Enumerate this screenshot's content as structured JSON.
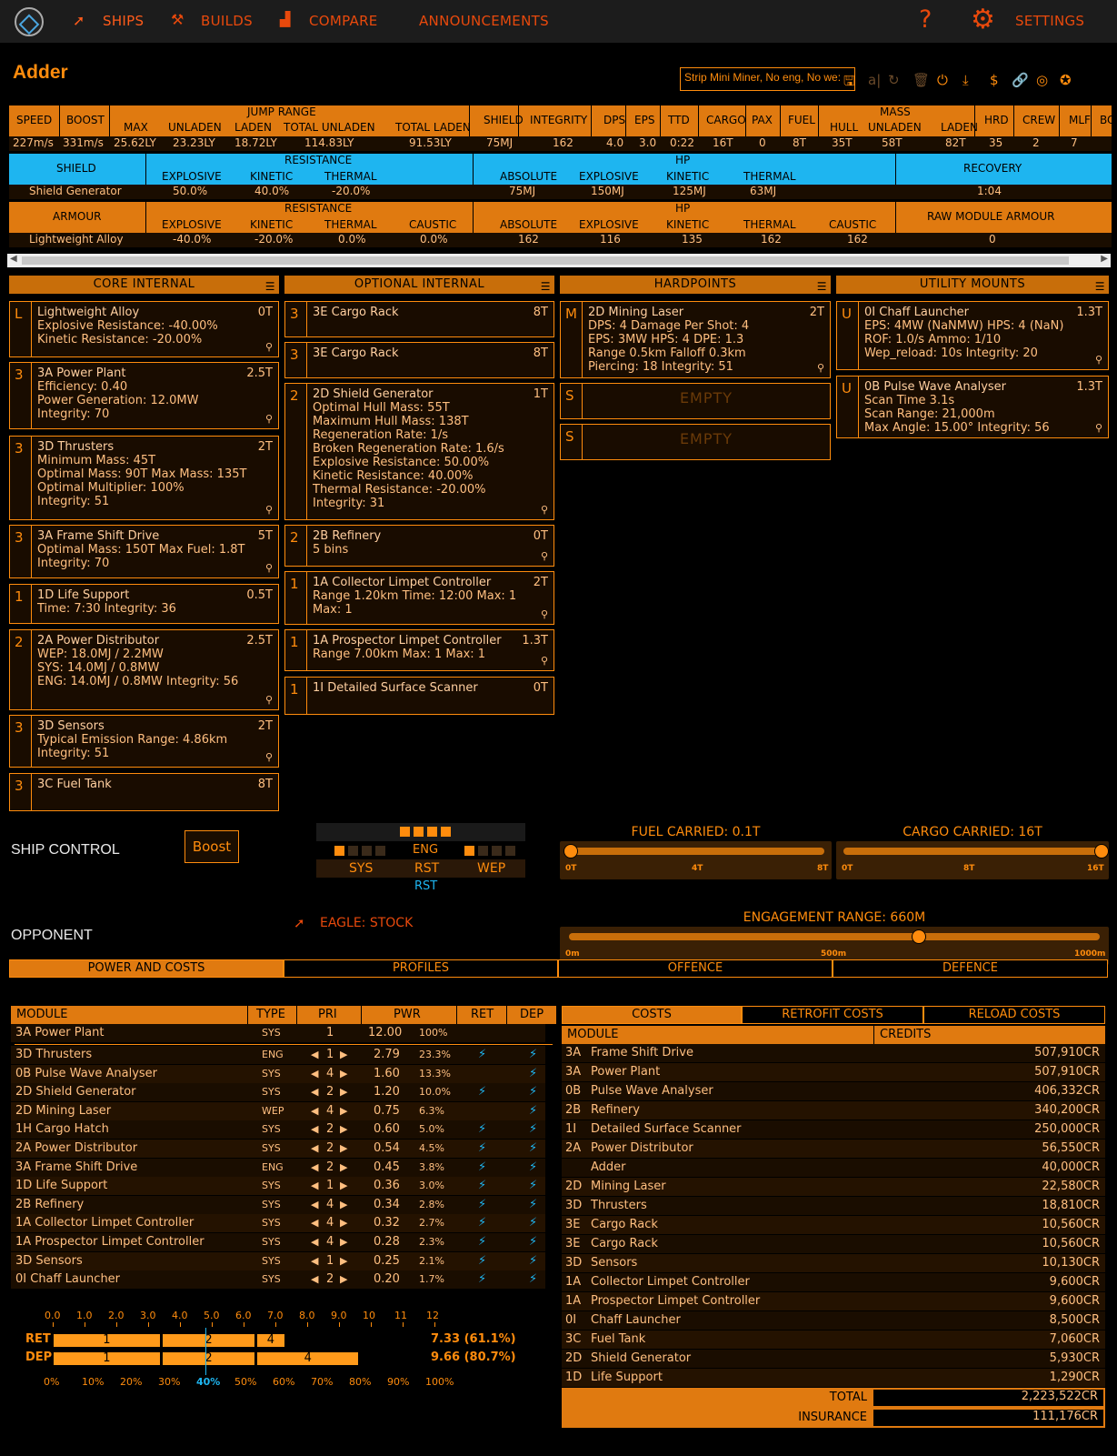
{
  "nav": {
    "ships": "SHIPS",
    "builds": "BUILDS",
    "compare": "COMPARE",
    "announcements": "ANNOUNCEMENTS",
    "help": "?",
    "settings": "SETTINGS"
  },
  "ship": {
    "name": "Adder",
    "build_name": "Strip Mini Miner, No eng, No we:"
  },
  "summary": {
    "headers": [
      "SPEED",
      "BOOST",
      "JUMP RANGE",
      "MAX",
      "UNLADEN",
      "LADEN",
      "TOTAL UNLADEN",
      "TOTAL LADEN",
      "SHIELD",
      "INTEGRITY",
      "DPS",
      "EPS",
      "TTD",
      "CARGO",
      "PAX",
      "FUEL",
      "MASS",
      "HULL",
      "UNLADEN",
      "LADEN",
      "HRD",
      "CREW",
      "MLF",
      "BO"
    ],
    "values": [
      "227m/s",
      "331m/s",
      "25.62LY",
      "23.23LY",
      "18.72LY",
      "114.83LY",
      "91.53LY",
      "75MJ",
      "162",
      "4.0",
      "3.0",
      "0:22",
      "16T",
      "0",
      "8T",
      "35T",
      "58T",
      "82T",
      "35",
      "2",
      "7"
    ]
  },
  "shield": {
    "label": "SHIELD",
    "resistance": "RESISTANCE",
    "hp": "HP",
    "recovery": "RECOVERY",
    "cols": [
      "EXPLOSIVE",
      "KINETIC",
      "THERMAL",
      "ABSOLUTE",
      "EXPLOSIVE",
      "KINETIC",
      "THERMAL"
    ],
    "name": "Shield Generator",
    "vals": [
      "50.0%",
      "40.0%",
      "-20.0%",
      "75MJ",
      "150MJ",
      "125MJ",
      "63MJ",
      "1:04"
    ]
  },
  "armour": {
    "label": "ARMOUR",
    "resistance": "RESISTANCE",
    "hp": "HP",
    "raw": "RAW MODULE ARMOUR",
    "cols": [
      "EXPLOSIVE",
      "KINETIC",
      "THERMAL",
      "CAUSTIC",
      "ABSOLUTE",
      "EXPLOSIVE",
      "KINETIC",
      "THERMAL",
      "CAUSTIC"
    ],
    "name": "Lightweight Alloy",
    "vals": [
      "-40.0%",
      "-20.0%",
      "0.0%",
      "0.0%",
      "162",
      "116",
      "135",
      "162",
      "162",
      "0"
    ]
  },
  "sections": {
    "core": "CORE INTERNAL",
    "optional": "OPTIONAL INTERNAL",
    "hardpoints": "HARDPOINTS",
    "utility": "UTILITY MOUNTS"
  },
  "core": [
    {
      "cls": "L",
      "mass": "0T",
      "lines": [
        "Lightweight Alloy",
        "Explosive Resistance: -40.00%",
        "Kinetic Resistance: -20.00%"
      ]
    },
    {
      "cls": "3",
      "mass": "2.5T",
      "lines": [
        "3A Power Plant",
        "Efficiency: 0.40",
        "Power Generation: 12.0MW",
        "Integrity: 70"
      ]
    },
    {
      "cls": "3",
      "mass": "2T",
      "lines": [
        "3D Thrusters",
        "Minimum Mass: 45T",
        "Optimal Mass: 90T  Max Mass: 135T",
        "Optimal Multiplier: 100%",
        "Integrity: 51"
      ]
    },
    {
      "cls": "3",
      "mass": "5T",
      "lines": [
        "3A Frame Shift Drive",
        "Optimal Mass: 150T  Max Fuel: 1.8T",
        "Integrity: 70"
      ]
    },
    {
      "cls": "1",
      "mass": "0.5T",
      "lines": [
        "1D Life Support",
        "Time: 7:30   Integrity: 36"
      ]
    },
    {
      "cls": "2",
      "mass": "2.5T",
      "lines": [
        "2A Power Distributor",
        "WEP: 18.0MJ / 2.2MW",
        "SYS: 14.0MJ / 0.8MW",
        "ENG: 14.0MJ / 0.8MW   Integrity: 56"
      ]
    },
    {
      "cls": "3",
      "mass": "2T",
      "lines": [
        "3D Sensors",
        "Typical Emission Range: 4.86km",
        "Integrity: 51"
      ]
    },
    {
      "cls": "3",
      "mass": "8T",
      "lines": [
        "3C Fuel Tank"
      ]
    }
  ],
  "optional": [
    {
      "cls": "3",
      "mass": "8T",
      "lines": [
        "3E Cargo Rack"
      ]
    },
    {
      "cls": "3",
      "mass": "8T",
      "lines": [
        "3E Cargo Rack"
      ]
    },
    {
      "cls": "2",
      "mass": "1T",
      "lines": [
        "2D Shield Generator",
        "Optimal Hull Mass: 55T",
        "Maximum Hull Mass: 138T",
        "Regeneration Rate: 1/s",
        "Broken Regeneration Rate: 1.6/s",
        "Explosive Resistance: 50.00%",
        "Kinetic Resistance: 40.00%",
        "Thermal Resistance: -20.00%",
        "Integrity: 31"
      ]
    },
    {
      "cls": "2",
      "mass": "0T",
      "lines": [
        "2B Refinery",
        "5 bins"
      ]
    },
    {
      "cls": "1",
      "mass": "2T",
      "lines": [
        "1A Collector Limpet Controller",
        "Range 1.20km  Time: 12:00  Max: 1",
        "Max: 1"
      ]
    },
    {
      "cls": "1",
      "mass": "1.3T",
      "lines": [
        "1A Prospector Limpet Controller",
        "Range 7.00km  Max: 1   Max: 1"
      ]
    },
    {
      "cls": "1",
      "mass": "0T",
      "lines": [
        "1I Detailed Surface Scanner"
      ]
    }
  ],
  "hardpoints": [
    {
      "cls": "M",
      "mass": "2T",
      "lines": [
        "2D Mining Laser",
        "DPS: 4   Damage Per Shot: 4",
        "EPS: 3MW  HPS: 4   DPE: 1.3",
        "Range 0.5km   Falloff 0.3km",
        "Piercing: 18   Integrity: 51"
      ]
    },
    {
      "cls": "S",
      "empty": "EMPTY"
    },
    {
      "cls": "S",
      "empty": "EMPTY"
    }
  ],
  "utility": [
    {
      "cls": "U",
      "mass": "1.3T",
      "lines": [
        "0I Chaff Launcher",
        "EPS: 4MW (NaNMW)   HPS: 4 (NaN)",
        "ROF: 1.0/s   Ammo: 1/10",
        "Wep_reload: 10s   Integrity: 20"
      ]
    },
    {
      "cls": "U",
      "mass": "1.3T",
      "lines": [
        "0B Pulse Wave Analyser",
        "Scan Time 3.1s",
        "Scan Range: 21,000m",
        "Max Angle: 15.00°   Integrity: 56"
      ]
    }
  ],
  "control": {
    "label": "SHIP CONTROL",
    "boost": "Boost",
    "eng": "ENG",
    "sys": "SYS",
    "rst": "RST",
    "wep": "WEP",
    "rst2": "RST",
    "fuel_label": "FUEL CARRIED: 0.1T",
    "fuel_ticks": [
      "0T",
      "4T",
      "8T"
    ],
    "fuel_level": 0.0125,
    "cargo_label": "CARGO CARRIED: 16T",
    "cargo_ticks": [
      "0T",
      "8T",
      "16T"
    ],
    "cargo_level": 1.0
  },
  "opponent": {
    "label": "OPPONENT",
    "ship": "EAGLE: STOCK",
    "range_label": "ENGAGEMENT RANGE: 660M",
    "range_ticks": [
      "0m",
      "500m",
      "1000m"
    ],
    "range_level": 0.66
  },
  "tabs": [
    "POWER AND COSTS",
    "PROFILES",
    "OFFENCE",
    "DEFENCE"
  ],
  "power": {
    "headers": [
      "MODULE",
      "TYPE",
      "PRI",
      "PWR",
      "RET",
      "DEP"
    ],
    "plant": {
      "name": "3A  Power Plant",
      "type": "SYS",
      "pri": "1",
      "pwr": "12.00",
      "pct": "100%"
    },
    "rows": [
      {
        "name": "3D  Thrusters",
        "type": "ENG",
        "pri": "1",
        "pwr": "2.79",
        "pct": "23.3%",
        "ret": true
      },
      {
        "name": "0B  Pulse Wave Analyser",
        "type": "SYS",
        "pri": "4",
        "pwr": "1.60",
        "pct": "13.3%",
        "ret": false
      },
      {
        "name": "2D  Shield Generator",
        "type": "SYS",
        "pri": "2",
        "pwr": "1.20",
        "pct": "10.0%",
        "ret": true
      },
      {
        "name": "2D  Mining Laser",
        "type": "WEP",
        "pri": "4",
        "pwr": "0.75",
        "pct": "6.3%",
        "ret": false
      },
      {
        "name": "1H  Cargo Hatch",
        "type": "SYS",
        "pri": "2",
        "pwr": "0.60",
        "pct": "5.0%",
        "ret": true
      },
      {
        "name": "2A  Power Distributor",
        "type": "SYS",
        "pri": "2",
        "pwr": "0.54",
        "pct": "4.5%",
        "ret": true
      },
      {
        "name": "3A  Frame Shift Drive",
        "type": "ENG",
        "pri": "2",
        "pwr": "0.45",
        "pct": "3.8%",
        "ret": true
      },
      {
        "name": "1D  Life Support",
        "type": "SYS",
        "pri": "1",
        "pwr": "0.36",
        "pct": "3.0%",
        "ret": true
      },
      {
        "name": "2B  Refinery",
        "type": "SYS",
        "pri": "4",
        "pwr": "0.34",
        "pct": "2.8%",
        "ret": true
      },
      {
        "name": "1A  Collector Limpet Controller",
        "type": "SYS",
        "pri": "4",
        "pwr": "0.32",
        "pct": "2.7%",
        "ret": true
      },
      {
        "name": "1A  Prospector Limpet Controller",
        "type": "SYS",
        "pri": "4",
        "pwr": "0.28",
        "pct": "2.3%",
        "ret": true
      },
      {
        "name": "3D  Sensors",
        "type": "SYS",
        "pri": "1",
        "pwr": "0.25",
        "pct": "2.1%",
        "ret": true
      },
      {
        "name": "0I  Chaff Launcher",
        "type": "SYS",
        "pri": "2",
        "pwr": "0.20",
        "pct": "1.7%",
        "ret": true
      }
    ]
  },
  "powerbar": {
    "top_ticks": [
      "0.0",
      "1.0",
      "2.0",
      "3.0",
      "4.0",
      "5.0",
      "6.0",
      "7.0",
      "8.0",
      "9.0",
      "10",
      "11",
      "12"
    ],
    "bottom_ticks": [
      "0%",
      "10%",
      "20%",
      "30%",
      "40%",
      "50%",
      "60%",
      "70%",
      "80%",
      "90%",
      "100%"
    ],
    "ret_label": "RET",
    "ret_value": "7.33 (61.1%)",
    "ret_segments": [
      {
        "label": "1",
        "value": 3.42
      },
      {
        "label": "2",
        "value": 2.99
      },
      {
        "label": "4",
        "value": 0.92
      }
    ],
    "dep_label": "DEP",
    "dep_value": "9.66 (80.7%)",
    "dep_segments": [
      {
        "label": "1",
        "value": 3.42
      },
      {
        "label": "2",
        "value": 2.99
      },
      {
        "label": "4",
        "value": 3.25
      }
    ]
  },
  "costs": {
    "tabs": [
      "COSTS",
      "RETROFIT COSTS",
      "RELOAD COSTS"
    ],
    "headers": [
      "MODULE",
      "CREDITS"
    ],
    "rows": [
      {
        "cls": "3A",
        "name": "Frame Shift Drive",
        "cr": "507,910CR"
      },
      {
        "cls": "3A",
        "name": "Power Plant",
        "cr": "507,910CR"
      },
      {
        "cls": "0B",
        "name": "Pulse Wave Analyser",
        "cr": "406,332CR"
      },
      {
        "cls": "2B",
        "name": "Refinery",
        "cr": "340,200CR"
      },
      {
        "cls": "1I",
        "name": "Detailed Surface Scanner",
        "cr": "250,000CR"
      },
      {
        "cls": "2A",
        "name": "Power Distributor",
        "cr": "56,550CR"
      },
      {
        "cls": "",
        "name": "Adder",
        "cr": "40,000CR"
      },
      {
        "cls": "2D",
        "name": "Mining Laser",
        "cr": "22,580CR"
      },
      {
        "cls": "3D",
        "name": "Thrusters",
        "cr": "18,810CR"
      },
      {
        "cls": "3E",
        "name": "Cargo Rack",
        "cr": "10,560CR"
      },
      {
        "cls": "3E",
        "name": "Cargo Rack",
        "cr": "10,560CR"
      },
      {
        "cls": "3D",
        "name": "Sensors",
        "cr": "10,130CR"
      },
      {
        "cls": "1A",
        "name": "Collector Limpet Controller",
        "cr": "9,600CR"
      },
      {
        "cls": "1A",
        "name": "Prospector Limpet Controller",
        "cr": "9,600CR"
      },
      {
        "cls": "0I",
        "name": "Chaff Launcher",
        "cr": "8,500CR"
      },
      {
        "cls": "3C",
        "name": "Fuel Tank",
        "cr": "7,060CR"
      },
      {
        "cls": "2D",
        "name": "Shield Generator",
        "cr": "5,930CR"
      },
      {
        "cls": "1D",
        "name": "Life Support",
        "cr": "1,290CR"
      }
    ],
    "total_label": "TOTAL",
    "total": "2,223,522CR",
    "insurance_label": "INSURANCE",
    "insurance": "111,176CR"
  },
  "colors": {
    "accent": "#ff8c0d",
    "header": "#e07a10",
    "blue": "#1eb5f0",
    "nav": "#e8490c"
  },
  "icons": [
    "rocket-icon",
    "hammer-icon",
    "chart-icon",
    "help-icon",
    "gear-icon",
    "save-icon",
    "undo-icon",
    "redo-icon",
    "trash-icon",
    "power-icon",
    "download-icon",
    "dollar-icon",
    "link-icon",
    "filter-icon",
    "bolt-icon",
    "wrench-icon"
  ]
}
